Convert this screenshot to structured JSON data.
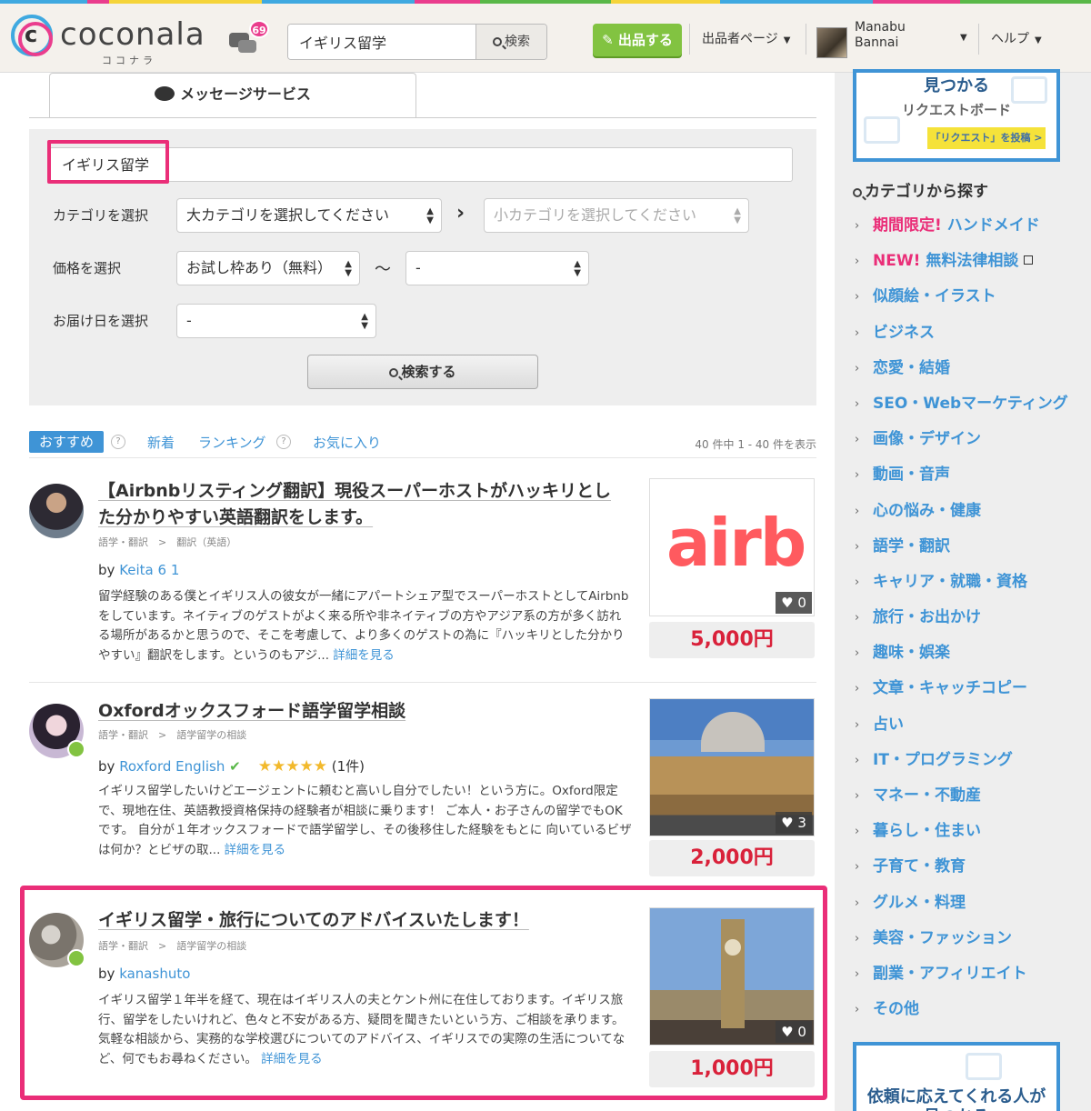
{
  "header": {
    "logo_text": "coconala",
    "logo_kana": "ココナラ",
    "message_badge": "69",
    "search_value": "イギリス留学",
    "search_button": "検索",
    "sell_button": "出品する",
    "seller_page": "出品者ページ",
    "username": "Manabu Bannai",
    "help": "ヘルプ"
  },
  "tab": {
    "label": "メッセージサービス"
  },
  "filters": {
    "keyword": "イギリス留学",
    "category_label": "カテゴリを選択",
    "major_category": "大カテゴリを選択してください",
    "minor_category": "小カテゴリを選択してください",
    "price_label": "価格を選択",
    "price_from": "お試し枠あり（無料）",
    "price_to": "-",
    "delivery_label": "お届け日を選択",
    "delivery": "-",
    "search_button": "検索する"
  },
  "sort": {
    "recommended": "おすすめ",
    "new": "新着",
    "ranking": "ランキング",
    "favorites": "お気に入り",
    "qmark": "?",
    "count": "40 件中 1 - 40 件を表示"
  },
  "listings": [
    {
      "title": "【Airbnbリスティング翻訳】現役スーパーホストがハッキリとした分かりやすい英語翻訳をします。",
      "category": "語学・翻訳　>　翻訳（英語）",
      "by": "by",
      "seller": "Keita 6 1",
      "description": "留学経験のある僕とイギリス人の彼女が一緒にアパートシェア型でスーパーホストとしてAirbnbをしています。ネイティブのゲストがよく来る所や非ネイティブの方やアジア系の方が多く訪れる場所があるかと思うので、そこを考慮して、より多くのゲストの為に『ハッキリとした分かりやすい』翻訳をします。というのもアジ...",
      "more": "詳細を見る",
      "thumb_text": "airb",
      "favorites": "0",
      "price": "5,000円"
    },
    {
      "title": "Oxfordオックスフォード語学留学相談",
      "category": "語学・翻訳　>　語学留学の相談",
      "by": "by",
      "seller": "Roxford English",
      "verified": "✔",
      "stars": "★★★★★",
      "rating_count": "(1件)",
      "description": "イギリス留学したいけどエージェントに頼むと高いし自分でしたい！という方に。Oxford限定で、現地在住、英語教授資格保持の経験者が相談に乗ります！ ご本人・お子さんの留学でもOKです。 自分が１年オックスフォードで語学留学し、その後移住した経験をもとに 向いているビザは何か？とビザの取...",
      "more": "詳細を見る",
      "favorites": "3",
      "price": "2,000円"
    },
    {
      "title": "イギリス留学・旅行についてのアドバイスいたします！",
      "category": "語学・翻訳　>　語学留学の相談",
      "by": "by",
      "seller": "kanashuto",
      "description": "イギリス留学１年半を経て、現在はイギリス人の夫とケント州に在住しております。イギリス旅行、留学をしたいけれど、色々と不安がある方、疑問を聞きたいという方、ご相談を承ります。気軽な相談から、実務的な学校選びについてのアドバイス、イギリスでの実際の生活についてなど、何でもお尋ねください。",
      "more": "詳細を見る",
      "favorites": "0",
      "price": "1,000円"
    }
  ],
  "sidebar": {
    "banner_top_line1": "見つかる",
    "banner_top_line2": "リクエストボード",
    "banner_top_button": "「リクエスト」を投稿 >",
    "category_heading": "カテゴリから探す",
    "categories": [
      {
        "tag": "期間限定!",
        "label": "ハンドメイド"
      },
      {
        "tag": "NEW!",
        "label": "無料法律相談"
      },
      {
        "tag": "",
        "label": "似顔絵・イラスト"
      },
      {
        "tag": "",
        "label": "ビジネス"
      },
      {
        "tag": "",
        "label": "恋愛・結婚"
      },
      {
        "tag": "",
        "label": "SEO・Webマーケティング"
      },
      {
        "tag": "",
        "label": "画像・デザイン"
      },
      {
        "tag": "",
        "label": "動画・音声"
      },
      {
        "tag": "",
        "label": "心の悩み・健康"
      },
      {
        "tag": "",
        "label": "語学・翻訳"
      },
      {
        "tag": "",
        "label": "キャリア・就職・資格"
      },
      {
        "tag": "",
        "label": "旅行・お出かけ"
      },
      {
        "tag": "",
        "label": "趣味・娯楽"
      },
      {
        "tag": "",
        "label": "文章・キャッチコピー"
      },
      {
        "tag": "",
        "label": "占い"
      },
      {
        "tag": "",
        "label": "IT・プログラミング"
      },
      {
        "tag": "",
        "label": "マネー・不動産"
      },
      {
        "tag": "",
        "label": "暮らし・住まい"
      },
      {
        "tag": "",
        "label": "子育て・教育"
      },
      {
        "tag": "",
        "label": "グルメ・料理"
      },
      {
        "tag": "",
        "label": "美容・ファッション"
      },
      {
        "tag": "",
        "label": "副業・アフィリエイト"
      },
      {
        "tag": "",
        "label": "その他"
      }
    ],
    "banner_bottom_line1": "依頼に応えてくれる人が",
    "banner_bottom_line2": "見つかる"
  }
}
